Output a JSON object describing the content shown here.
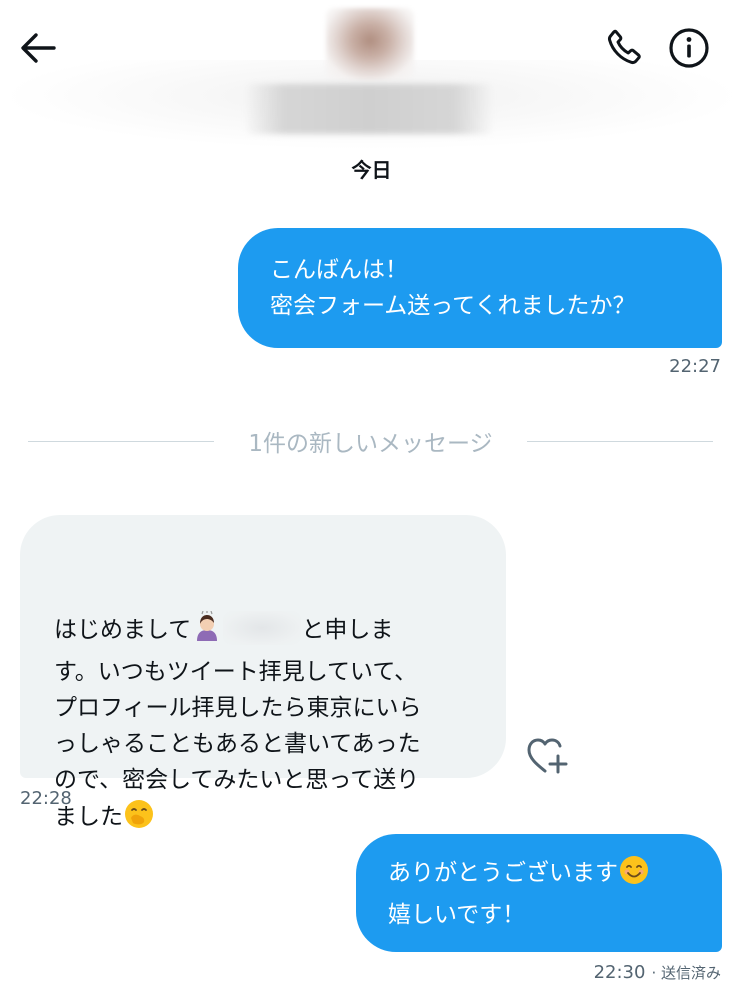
{
  "header": {
    "back_icon": "arrow-left-icon",
    "call_icon": "phone-icon",
    "info_icon": "info-icon",
    "day_label": "今日"
  },
  "messages": [
    {
      "direction": "outgoing",
      "lines": [
        "こんばんは！",
        "密会フォーム送ってくれましたか？"
      ],
      "time": "22:27"
    },
    {
      "direction": "incoming",
      "segments": {
        "l1_a": "はじめまして",
        "l1_b": "と申しま",
        "l2": "す。いつもツイート拝見していて、",
        "l3": "プロフィール拝見したら東京にいら",
        "l4": "っしゃることもあると書いてあった",
        "l5": "ので、密会してみたいと思って送り",
        "l6": "ました"
      },
      "time": "22:28"
    },
    {
      "direction": "outgoing",
      "lines": [
        "ありがとうございます",
        "嬉しいです！"
      ],
      "time": "22:30",
      "status": "· 送信済み"
    }
  ],
  "divider": {
    "label": "1件の新しいメッセージ"
  },
  "reaction": {
    "icon": "heart-plus-icon"
  },
  "colors": {
    "accent": "#1d9bf0",
    "incoming_bg": "#eff3f4",
    "muted": "#536471",
    "divider": "#cfd9de"
  }
}
